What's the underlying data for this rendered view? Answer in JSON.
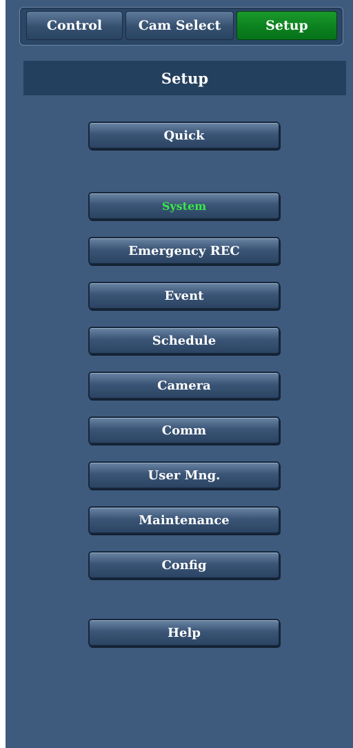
{
  "tabs": {
    "control": "Control",
    "cam_select": "Cam Select",
    "setup": "Setup",
    "active_color": "#0b7f1e"
  },
  "header": {
    "title": "Setup"
  },
  "menu": {
    "quick": "Quick",
    "system": "System",
    "emergency_rec": "Emergency REC",
    "event": "Event",
    "schedule": "Schedule",
    "camera": "Camera",
    "comm": "Comm",
    "user_mng": "User Mng.",
    "maintenance": "Maintenance",
    "config": "Config",
    "help": "Help",
    "active_item_color": "#39e84a"
  }
}
